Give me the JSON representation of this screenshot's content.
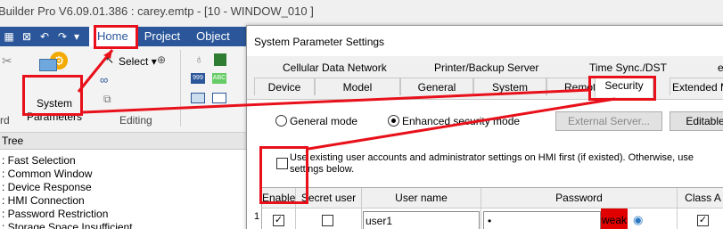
{
  "app": {
    "title": "Builder Pro V6.09.01.386 : carey.emtp - [10 - WINDOW_010 ]"
  },
  "menu": {
    "tabs": [
      "Home",
      "Project",
      "Object"
    ]
  },
  "ribbon": {
    "system_parameters_label": "System\nParameters",
    "select_label": "Select",
    "editing_label": "Editing",
    "left_group_fragment": "rd",
    "abc_icon_text": "ABC",
    "num_icon_text": "999"
  },
  "tree": {
    "header": "Tree",
    "items": [
      ": Fast Selection",
      ": Common Window",
      ": Device Response",
      ": HMI Connection",
      ": Password Restriction",
      ": Storage Space Insufficient"
    ]
  },
  "dialog": {
    "title": "System Parameter Settings",
    "tabs_row1": [
      "Cellular Data Network",
      "Printer/Backup Server",
      "Time Sync./DST",
      "e-"
    ],
    "tabs_row2": [
      "Device",
      "Model",
      "General",
      "System",
      "Remote",
      "Security",
      "Extended M"
    ],
    "mode_general": "General mode",
    "mode_enhanced": "Enhanced security mode",
    "external_server_btn": "External Server...",
    "editable_btn": "Editable",
    "use_existing_text": "Use existing user accounts and administrator settings on HMI first (if existed). Otherwise, use settings below.",
    "grid": {
      "headers": [
        "Enable",
        "Secret user",
        "User name",
        "Password",
        "Class A"
      ],
      "rows": [
        {
          "num": "1",
          "enable": true,
          "secret": false,
          "user": "user1",
          "password": "•",
          "strength": "weak",
          "classA": true
        }
      ]
    }
  },
  "colors": {
    "annotation": "#e8101a",
    "ribbon_blue": "#2b579a",
    "weak": "#e00000"
  }
}
